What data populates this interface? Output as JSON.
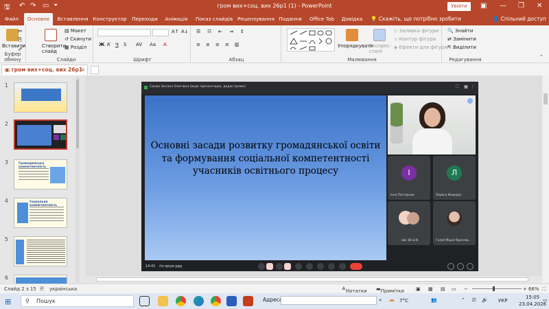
{
  "app": {
    "window_title": "гром вих+соц. вих 26р1 (1)  -  PowerPoint",
    "login_label": "Увійти",
    "colors": {
      "accent": "#b7472a",
      "selected_slide_border": "#c0392b"
    }
  },
  "tabs": [
    {
      "label": "Файл"
    },
    {
      "label": "Основне"
    },
    {
      "label": "Вставлення"
    },
    {
      "label": "Конструктор"
    },
    {
      "label": "Переходи"
    },
    {
      "label": "Анімація"
    },
    {
      "label": "Показ слайдів"
    },
    {
      "label": "Рецензування"
    },
    {
      "label": "Подання"
    },
    {
      "label": "Office Tab"
    },
    {
      "label": "Довідка"
    }
  ],
  "tell_me": "Скажіть, що потрібно зробити",
  "share": "Спільний доступ",
  "ribbon": {
    "clipboard": {
      "paste": "Вставити",
      "label": "Буфер обміну"
    },
    "slides": {
      "new_slide": "Створити слайд",
      "layout": "Макет",
      "reset": "Скинути",
      "section": "Розділ",
      "label": "Слайди"
    },
    "font": {
      "label": "Шрифт",
      "bold": "Ж",
      "italic": "К",
      "underline": "Ч",
      "strike": "S"
    },
    "paragraph": {
      "label": "Абзац"
    },
    "drawing": {
      "arrange": "Упорядкувати",
      "quick_styles": "Експрес-стилі",
      "fill": "Заливка фігури",
      "outline": "Контур фігури",
      "effects": "Ефекти для фігури",
      "label": "Малювання"
    },
    "editing": {
      "find": "Знайти",
      "replace": "Замінити",
      "select": "Виділити",
      "label": "Редагування"
    }
  },
  "document_tab": {
    "title": "гром вих+соц. вих 26р1 (1)",
    "close": "×"
  },
  "thumbnails": [
    {
      "num": "1",
      "selected": false
    },
    {
      "num": "2",
      "selected": true
    },
    {
      "num": "3",
      "selected": false,
      "heading": "Громадянська компетентність"
    },
    {
      "num": "4",
      "selected": false,
      "heading": "Соціальна компетентність"
    },
    {
      "num": "5",
      "selected": false
    },
    {
      "num": "6",
      "selected": false
    }
  ],
  "meet": {
    "top_text": "Сасюк Оксана Олегівна (веде презентацію, додає прямо)",
    "presentation_title": "Основні засади розвитку громадянської освіти та формування соціальної компетентності учасників освітнього процесу",
    "time": "14:41",
    "code": "rtz-qeyw-pgq",
    "participants": [
      {
        "name": "Інна Пастернак",
        "initial": "І",
        "color": "#7b2fa3"
      },
      {
        "name": "Лариса Федорук",
        "initial": "Л",
        "color": "#1e7a52"
      },
      {
        "name": "Ще 38 осіб",
        "initial": "",
        "color": "#3c4043"
      },
      {
        "name": "Голуб Марія Ярослав...",
        "initial": "",
        "color": "#3c4043"
      }
    ]
  },
  "status": {
    "slide_pos": "Слайд 2 з 15",
    "language": "українська",
    "notes": "Нотатки",
    "comments": "Примітки",
    "zoom": "66%"
  },
  "taskbar": {
    "search": "Пошук",
    "address_label": "Адреса",
    "temp": "7°C",
    "lang": "УКР",
    "time": "15:05",
    "date": "23.04.2026"
  }
}
